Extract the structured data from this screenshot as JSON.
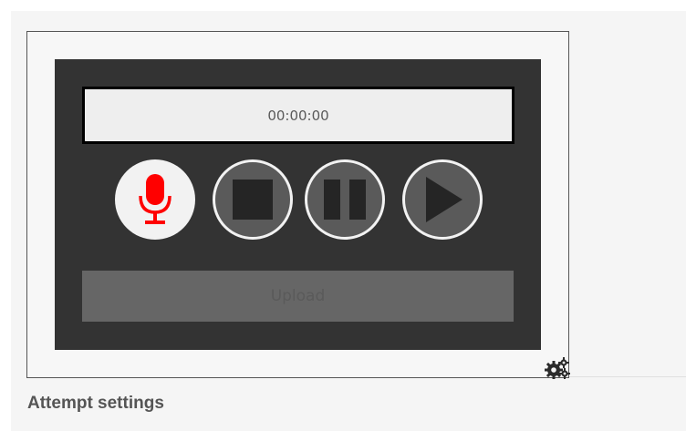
{
  "recorder": {
    "timer_text": "00:00:00",
    "upload_label": "Upload",
    "controls": [
      {
        "name": "record",
        "icon": "microphone-icon"
      },
      {
        "name": "stop",
        "icon": "stop-icon"
      },
      {
        "name": "pause",
        "icon": "pause-icon"
      },
      {
        "name": "play",
        "icon": "play-icon"
      }
    ]
  },
  "settings": {
    "icon": "gears-icon"
  },
  "section": {
    "title": "Attempt settings"
  },
  "colors": {
    "recorder_bg": "#333333",
    "record_accent": "#ff0000",
    "button_dark": "#5a5a5a",
    "upload_bg": "#666666"
  }
}
